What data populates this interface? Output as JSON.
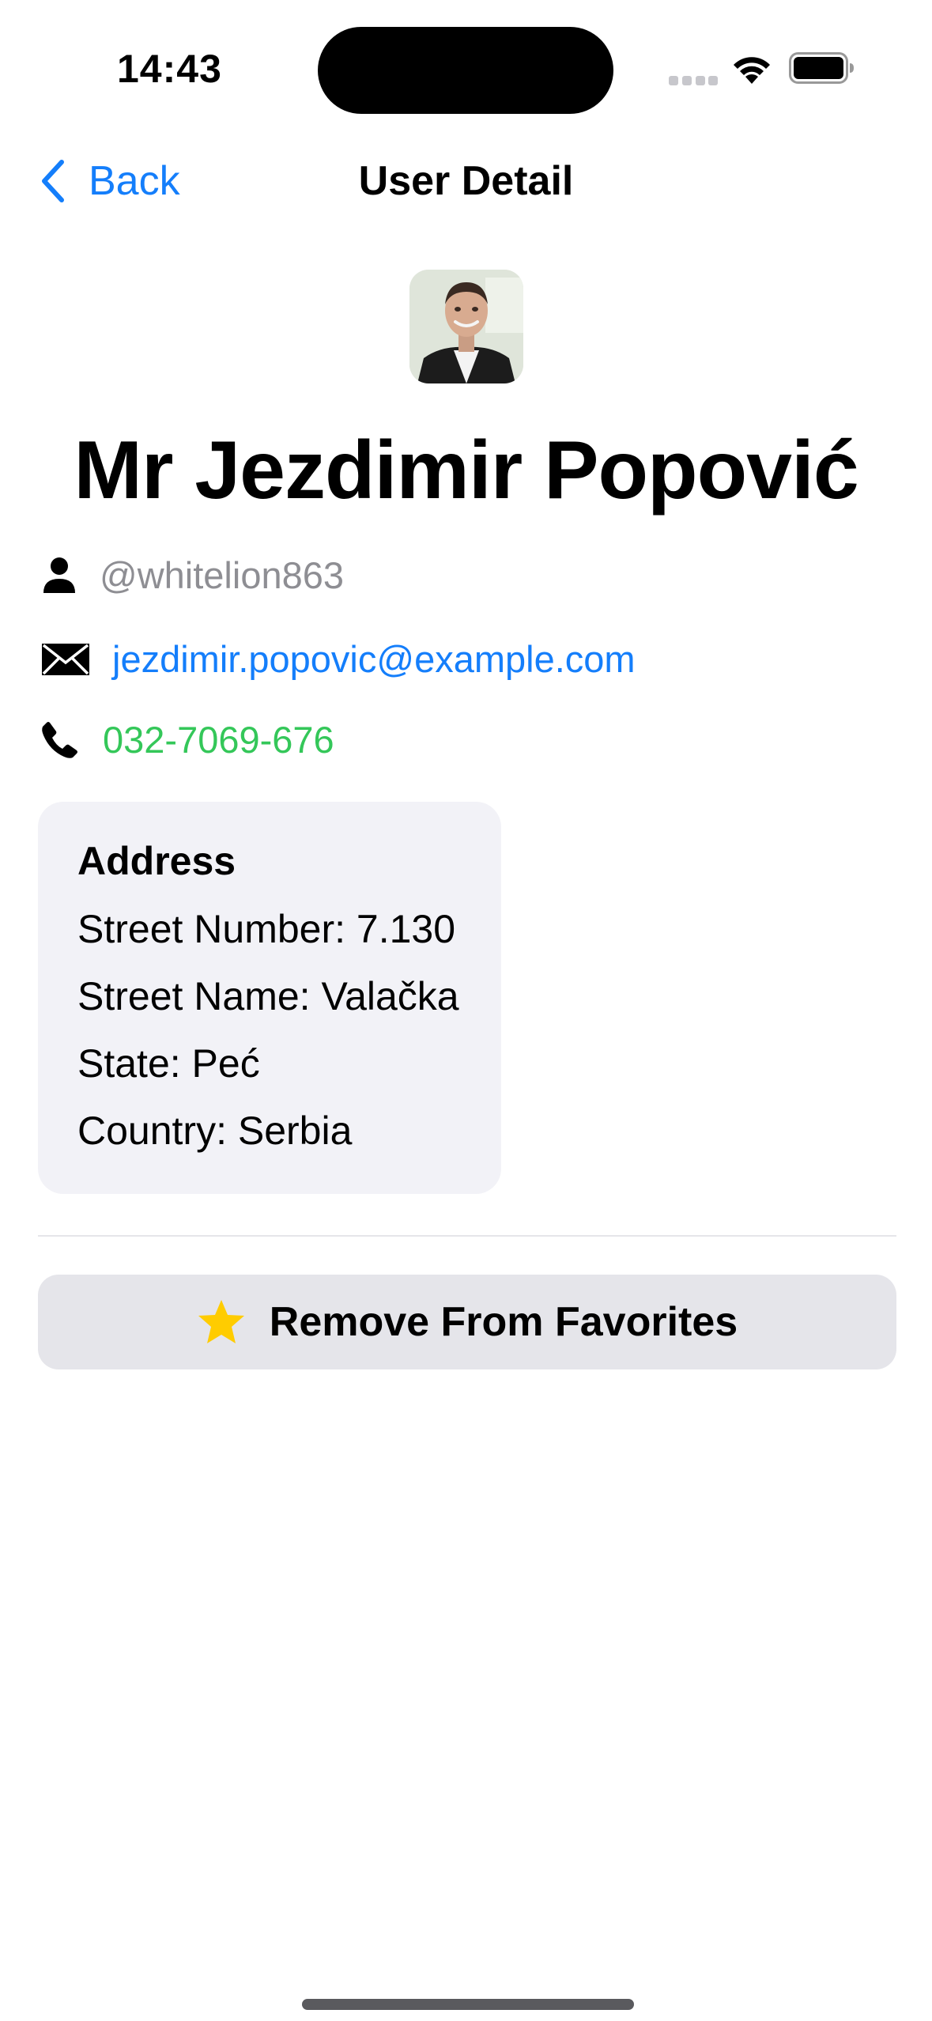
{
  "status_bar": {
    "time": "14:43",
    "signal_icon": "cellular-dots-icon",
    "wifi_icon": "wifi-icon",
    "battery_icon": "battery-icon"
  },
  "nav": {
    "back_label": "Back",
    "back_icon": "chevron-left-icon",
    "title": "User Detail"
  },
  "user": {
    "full_name": "Mr Jezdimir Popović",
    "username": "@whitelion863",
    "email": "jezdimir.popovic@example.com",
    "phone": "032-7069-676"
  },
  "address": {
    "title": "Address",
    "street_number": "Street Number: 7.130",
    "street_name": "Street Name: Valačka",
    "state": "State: Peć",
    "country": "Country: Serbia"
  },
  "favorites_button": {
    "label": "Remove From Favorites",
    "icon": "star-icon"
  },
  "colors": {
    "accent_blue": "#147efb",
    "phone_green": "#34c759",
    "star_yellow": "#ffcc00",
    "card_bg": "#f2f2f7",
    "button_bg": "#e5e5ea",
    "secondary_text": "#8e8e93"
  }
}
